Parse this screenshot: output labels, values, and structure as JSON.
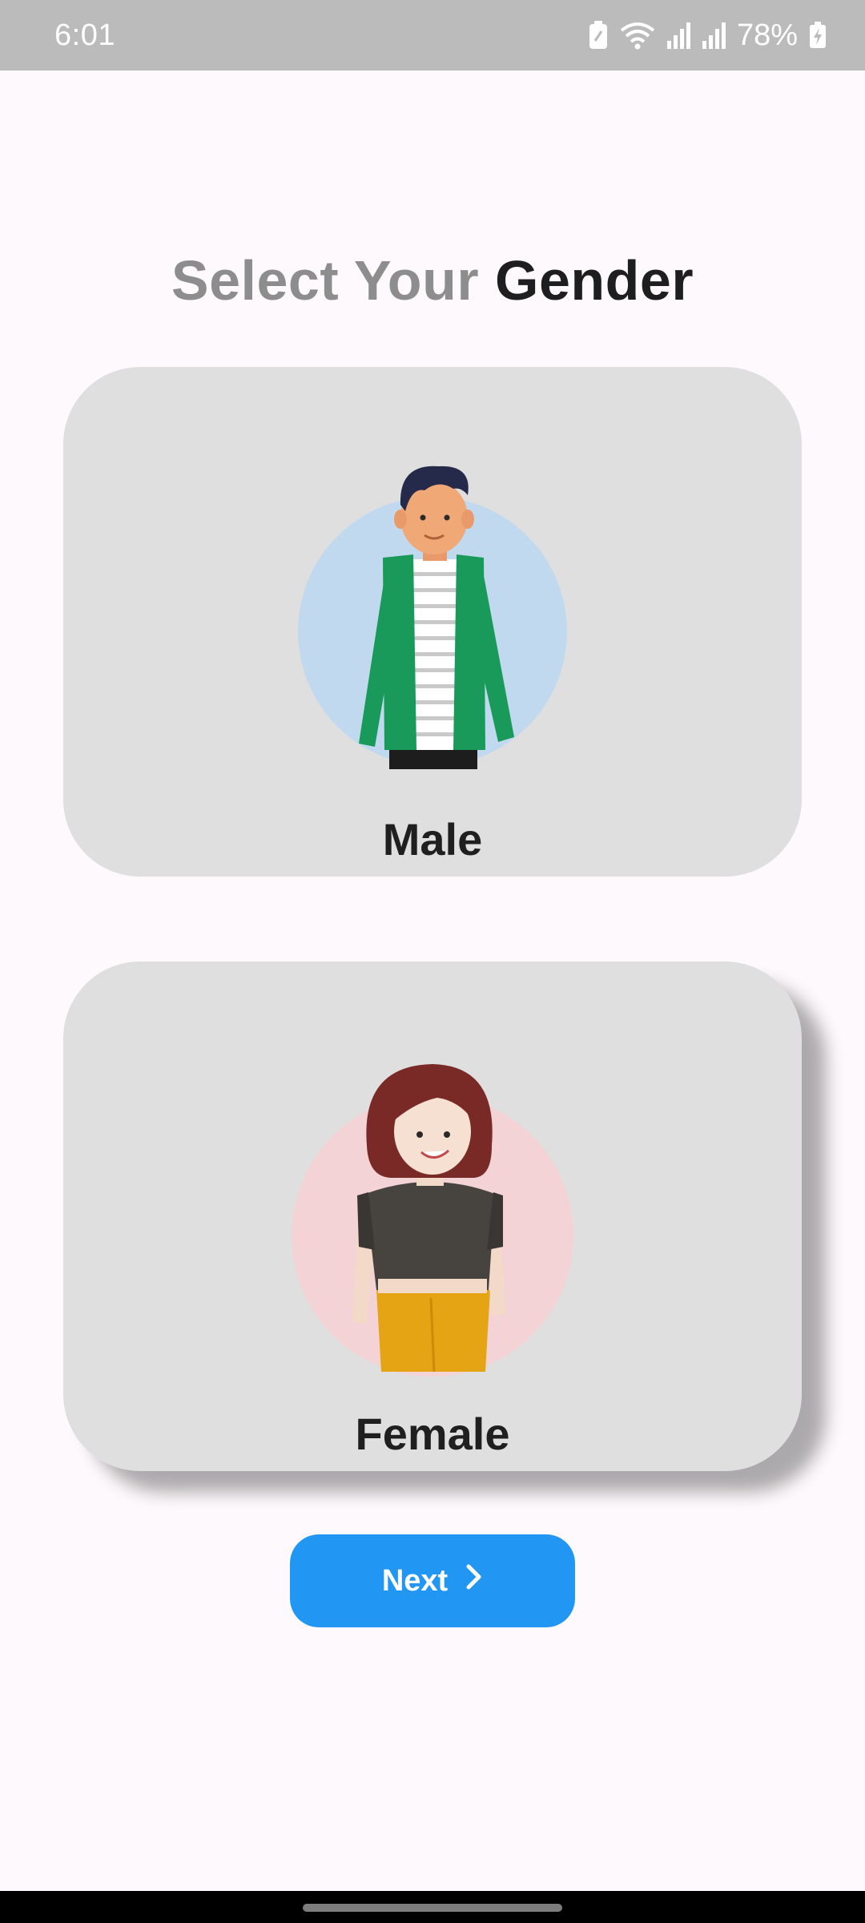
{
  "status_bar": {
    "time": "6:01",
    "battery_percent": "78%",
    "icons": [
      "battery-saver-icon",
      "wifi-icon",
      "signal-icon",
      "signal-icon",
      "battery-charging-icon"
    ]
  },
  "title": {
    "prefix": "Select Your",
    "emphasis": "Gender"
  },
  "options": {
    "male": {
      "label": "Male",
      "avatar_bg": "#c0d9ef",
      "shirt_color": "#1a9a5a"
    },
    "female": {
      "label": "Female",
      "avatar_bg": "#f4d3d6",
      "pants_color": "#e5a413"
    }
  },
  "next_button": {
    "label": "Next",
    "icon": "chevron-right-icon",
    "color": "#2196f3"
  }
}
